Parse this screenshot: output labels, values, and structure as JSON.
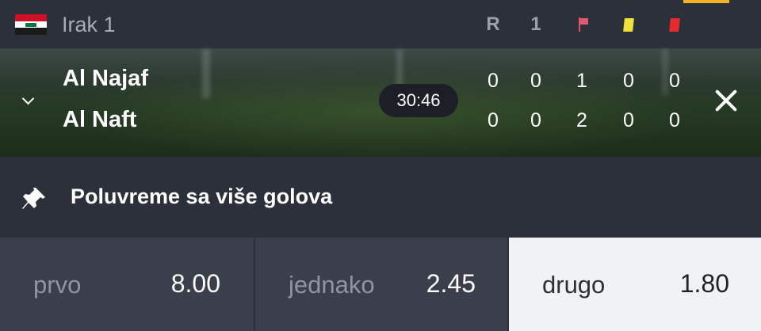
{
  "league": {
    "name": "Irak 1",
    "flag_icon": "iraq-flag-icon",
    "columns": {
      "r_label": "R",
      "first_half_label": "1",
      "corners_icon": "corner-flag-icon",
      "yellow_icon": "yellow-card-icon",
      "red_icon": "red-card-icon"
    }
  },
  "match": {
    "home": {
      "name": "Al Najaf",
      "score": "0",
      "first_half": "0",
      "corners": "1",
      "yellow": "0",
      "red": "0"
    },
    "away": {
      "name": "Al Naft",
      "score": "0",
      "first_half": "0",
      "corners": "2",
      "yellow": "0",
      "red": "0"
    },
    "clock": "30:46"
  },
  "market": {
    "title": "Poluvreme sa više golova",
    "pin_icon": "pin-icon"
  },
  "odds": [
    {
      "label": "prvo",
      "value": "8.00",
      "selected": false
    },
    {
      "label": "jednako",
      "value": "2.45",
      "selected": false
    },
    {
      "label": "drugo",
      "value": "1.80",
      "selected": true
    }
  ],
  "colors": {
    "accent": "#f0b323",
    "selected_bg": "#f1f2f4",
    "panel_bg": "#2b303b",
    "odd_bg": "#3a3f4b"
  }
}
